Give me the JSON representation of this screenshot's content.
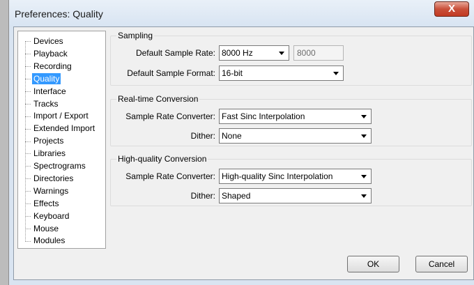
{
  "window": {
    "title": "Preferences: Quality",
    "close_label": "X"
  },
  "tree": {
    "items": [
      {
        "label": "Devices",
        "selected": false
      },
      {
        "label": "Playback",
        "selected": false
      },
      {
        "label": "Recording",
        "selected": false
      },
      {
        "label": "Quality",
        "selected": true
      },
      {
        "label": "Interface",
        "selected": false
      },
      {
        "label": "Tracks",
        "selected": false
      },
      {
        "label": "Import / Export",
        "selected": false
      },
      {
        "label": "Extended Import",
        "selected": false
      },
      {
        "label": "Projects",
        "selected": false
      },
      {
        "label": "Libraries",
        "selected": false
      },
      {
        "label": "Spectrograms",
        "selected": false
      },
      {
        "label": "Directories",
        "selected": false
      },
      {
        "label": "Warnings",
        "selected": false
      },
      {
        "label": "Effects",
        "selected": false
      },
      {
        "label": "Keyboard",
        "selected": false
      },
      {
        "label": "Mouse",
        "selected": false
      },
      {
        "label": "Modules",
        "selected": false
      }
    ]
  },
  "sampling": {
    "title": "Sampling",
    "rate_label": "Default Sample Rate:",
    "rate_value": "8000 Hz",
    "rate_custom": "8000",
    "format_label": "Default Sample Format:",
    "format_value": "16-bit"
  },
  "realtime": {
    "title": "Real-time Conversion",
    "converter_label": "Sample Rate Converter:",
    "converter_value": "Fast Sinc Interpolation",
    "dither_label": "Dither:",
    "dither_value": "None"
  },
  "highquality": {
    "title": "High-quality Conversion",
    "converter_label": "Sample Rate Converter:",
    "converter_value": "High-quality Sinc Interpolation",
    "dither_label": "Dither:",
    "dither_value": "Shaped"
  },
  "buttons": {
    "ok": "OK",
    "cancel": "Cancel"
  }
}
